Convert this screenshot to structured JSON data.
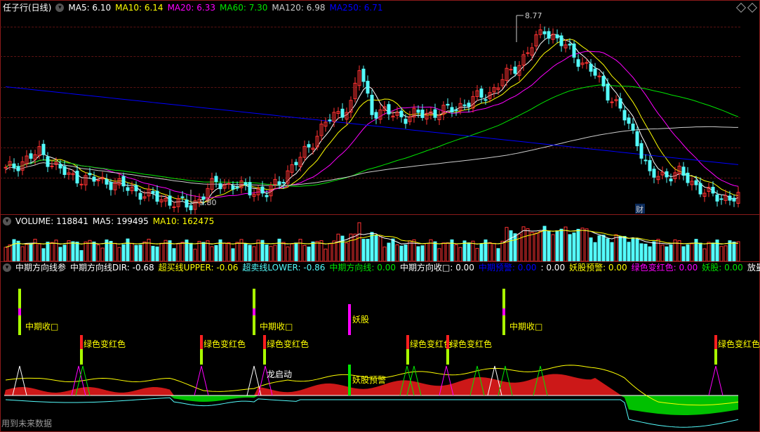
{
  "colors": {
    "up": "#ff3232",
    "down": "#54fcfc",
    "ma5": "#ffffff",
    "ma10": "#ffff00",
    "ma20": "#ff00ff",
    "ma60": "#00e600",
    "ma120": "#cccccc",
    "ma250": "#0000ff",
    "border": "#8b1a1a"
  },
  "price_panel": {
    "title": "任子行(日线)",
    "legend": [
      {
        "label": "MA5:",
        "value": "6.10",
        "color": "#ffffff"
      },
      {
        "label": "MA10:",
        "value": "6.14",
        "color": "#ffff00"
      },
      {
        "label": "MA20:",
        "value": "6.33",
        "color": "#ff00ff"
      },
      {
        "label": "MA60:",
        "value": "7.30",
        "color": "#00e600"
      },
      {
        "label": "MA120:",
        "value": "6.98",
        "color": "#cccccc"
      },
      {
        "label": "MA250:",
        "value": "6.71",
        "color": "#0000ff"
      }
    ],
    "high_label": "8.77",
    "low_label": "5.80",
    "cai_label": "财"
  },
  "volume_panel": {
    "legend": [
      {
        "label": "VOLUME:",
        "value": "118841",
        "color": "#ffffff"
      },
      {
        "label": "MA5:",
        "value": "199495",
        "color": "#ffffff"
      },
      {
        "label": "MA10:",
        "value": "162475",
        "color": "#ffff00"
      }
    ]
  },
  "indicator_panel": {
    "legend": [
      {
        "label": "中期方向线参",
        "value": "",
        "color": "#ffffff"
      },
      {
        "label": "中期方向线DIR:",
        "value": "-0.68",
        "color": "#ffffff"
      },
      {
        "label": "超买线UPPER:",
        "value": "-0.06",
        "color": "#ffff00"
      },
      {
        "label": "超卖线LOWER:",
        "value": "-0.86",
        "color": "#54fcfc"
      },
      {
        "label": "中期方向线:",
        "value": "0.00",
        "color": "#00e600"
      },
      {
        "label": "中期方向收□:",
        "value": "0.00",
        "color": "#ffffff"
      },
      {
        "label": "中期预警:",
        "value": "0.00",
        "color": "#0000ff"
      },
      {
        "label": ":",
        "value": "0.00",
        "color": "#ffffff"
      },
      {
        "label": "妖股预警:",
        "value": "0.00",
        "color": "#ffff00"
      },
      {
        "label": "绿色变红色:",
        "value": "0.00",
        "color": "#ff00ff"
      },
      {
        "label": "妖股:",
        "value": "0.00",
        "color": "#00e600"
      },
      {
        "label": "放量突破",
        "value": "",
        "color": "#ffffff"
      }
    ],
    "signals": {
      "mid_close": "中期收□",
      "green_to_red": "绿色变红色",
      "demon": "妖股",
      "dragon": "龙启动",
      "demon_alert": "妖股预警"
    }
  },
  "footer": "用到未来数据"
}
